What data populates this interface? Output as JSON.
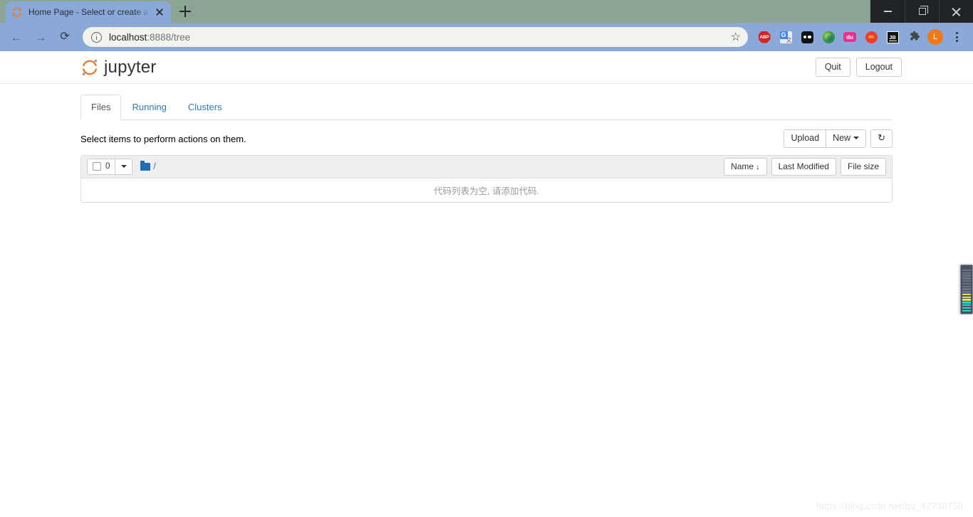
{
  "browser": {
    "tab": {
      "title": "Home Page - Select or create a",
      "favicon": "jupyter-favicon",
      "close": "×"
    },
    "new_tab_label": "+",
    "window_controls": {
      "minimize": "minimize-icon",
      "maximize": "restore-icon",
      "close": "close-icon"
    },
    "nav": {
      "back": "←",
      "forward": "→",
      "reload": "⟳"
    },
    "url": {
      "host": "localhost",
      "path": ":8888/tree",
      "security_icon": "info-circle-icon",
      "bookmark_icon": "☆"
    },
    "extensions": [
      {
        "name": "adblock-plus",
        "label": "ABP"
      },
      {
        "name": "google-translate",
        "label": "G"
      },
      {
        "name": "two-dots-extension",
        "label": ""
      },
      {
        "name": "internet-download-manager",
        "label": ""
      },
      {
        "name": "baidu-extension",
        "label": "du"
      },
      {
        "name": "infinity-newtab",
        "label": "∞"
      },
      {
        "name": "jetbrains-toolbox",
        "label": "JB"
      },
      {
        "name": "extensions-puzzle",
        "label": "🧩"
      }
    ],
    "profile_initial": "L",
    "menu_icon": "kebab-menu-icon"
  },
  "jupyter": {
    "brand": "jupyter",
    "header_buttons": [
      {
        "name": "quit-button",
        "label": "Quit"
      },
      {
        "name": "logout-button",
        "label": "Logout"
      }
    ],
    "tabs": [
      {
        "name": "tab-files",
        "label": "Files",
        "active": true
      },
      {
        "name": "tab-running",
        "label": "Running",
        "active": false
      },
      {
        "name": "tab-clusters",
        "label": "Clusters",
        "active": false
      }
    ],
    "actions": {
      "hint": "Select items to perform actions on them.",
      "upload_label": "Upload",
      "new_label": "New",
      "refresh_icon": "refresh-icon"
    },
    "filelist": {
      "selected_count": "0",
      "breadcrumb_root": "/",
      "folder_icon": "folder-icon",
      "sort_buttons": [
        {
          "name": "sort-name",
          "label": "Name",
          "arrow": "↓"
        },
        {
          "name": "sort-last-modified",
          "label": "Last Modified",
          "arrow": ""
        },
        {
          "name": "sort-file-size",
          "label": "File size",
          "arrow": ""
        }
      ],
      "empty_message": "代码列表为空, 请添加代码."
    }
  },
  "watermark": "https://blog.csdn.net/qq_42730750",
  "equalizer": {
    "name": "audio-level-meter",
    "bars": [
      "#34d0c4",
      "#34d0c4",
      "#34d0c4",
      "#34d0c4",
      "#e8e24a",
      "#e8e24a",
      "#e8e24a",
      "#6b7282",
      "#6b7282",
      "#6b7282",
      "#6b7282",
      "#6b7282",
      "#6b7282",
      "#6b7282",
      "#6b7282",
      "#6b7282"
    ]
  },
  "colors": {
    "tabstrip": "#8ba494",
    "toolbar": "#8aa8d8",
    "accent_orange": "#f37726",
    "link_blue": "#337ab7"
  }
}
